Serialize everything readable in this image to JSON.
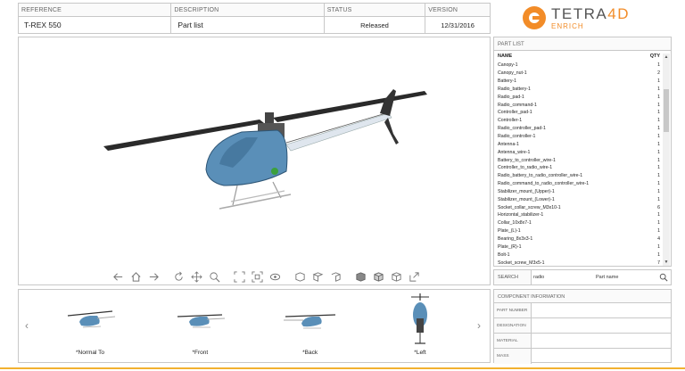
{
  "header": {
    "reference_label": "REFERENCE",
    "reference_value": "T-REX 550",
    "description_label": "DESCRIPTION",
    "description_value": "Part list",
    "status_label": "STATUS",
    "status_value": "Released",
    "version_label": "VERSION",
    "version_value": "12/31/2016"
  },
  "logo": {
    "title_a": "TETRA",
    "title_b": "4D",
    "subtitle": "ENRICH"
  },
  "toolbar": {
    "icons": [
      "arrow-left-icon",
      "home-icon",
      "arrow-right-icon",
      "rotate-icon",
      "pan-icon",
      "zoom-icon",
      "fit-all-icon",
      "fit-selection-icon",
      "view-front-icon",
      "view-top-icon",
      "view-side-icon",
      "shaded-icon",
      "wireframe-icon",
      "transparent-icon",
      "fullscreen-icon"
    ]
  },
  "part_list": {
    "title": "PART LIST",
    "col_name": "NAME",
    "col_qty": "QTY",
    "rows": [
      {
        "name": "Canopy-1",
        "qty": "1"
      },
      {
        "name": "Canopy_nut-1",
        "qty": "2"
      },
      {
        "name": "Battery-1",
        "qty": "1"
      },
      {
        "name": "Radio_battery-1",
        "qty": "1"
      },
      {
        "name": "Radio_pad-1",
        "qty": "1"
      },
      {
        "name": "Radio_command-1",
        "qty": "1"
      },
      {
        "name": "Controller_pad-1",
        "qty": "1"
      },
      {
        "name": "Controller-1",
        "qty": "1"
      },
      {
        "name": "Radio_controller_pad-1",
        "qty": "1"
      },
      {
        "name": "Radio_controller-1",
        "qty": "1"
      },
      {
        "name": "Antenna-1",
        "qty": "1"
      },
      {
        "name": "Antenna_wire-1",
        "qty": "1"
      },
      {
        "name": "Battery_to_controller_wire-1",
        "qty": "1"
      },
      {
        "name": "Controller_to_radio_wire-1",
        "qty": "1"
      },
      {
        "name": "Radio_battery_to_radio_controller_wire-1",
        "qty": "1"
      },
      {
        "name": "Radio_command_to_radio_controller_wire-1",
        "qty": "1"
      },
      {
        "name": "Stabilizer_mount_(Upper)-1",
        "qty": "1"
      },
      {
        "name": "Stabilizer_mount_(Lower)-1",
        "qty": "1"
      },
      {
        "name": "Socket_collar_screw_M3x10-1",
        "qty": "6"
      },
      {
        "name": "Horizontal_stabilizer-1",
        "qty": "1"
      },
      {
        "name": "Collar_10x8x7-1",
        "qty": "1"
      },
      {
        "name": "Plate_(L)-1",
        "qty": "1"
      },
      {
        "name": "Bearing_8x3x3-1",
        "qty": "4"
      },
      {
        "name": "Plate_(R)-1",
        "qty": "1"
      },
      {
        "name": "Bolt-1",
        "qty": "1"
      },
      {
        "name": "Socket_screw_M3x5-1",
        "qty": "7"
      }
    ]
  },
  "search": {
    "label": "SEARCH",
    "field": "radio",
    "property": "Part name"
  },
  "views": {
    "prev": "‹",
    "next": "›",
    "items": [
      {
        "label": "*Normal To"
      },
      {
        "label": "*Front"
      },
      {
        "label": "*Back"
      },
      {
        "label": "*Left"
      }
    ]
  },
  "component_info": {
    "title": "COMPONENT INFORMATION",
    "fields": [
      {
        "key": "PART NUMBER",
        "value": ""
      },
      {
        "key": "DESIGNATION",
        "value": ""
      },
      {
        "key": "MATERIAL",
        "value": ""
      },
      {
        "key": "MASS",
        "value": ""
      }
    ]
  },
  "colors": {
    "accent": "#f28c28",
    "canopy": "#5a8fb8",
    "border": "#c8c8c8"
  }
}
